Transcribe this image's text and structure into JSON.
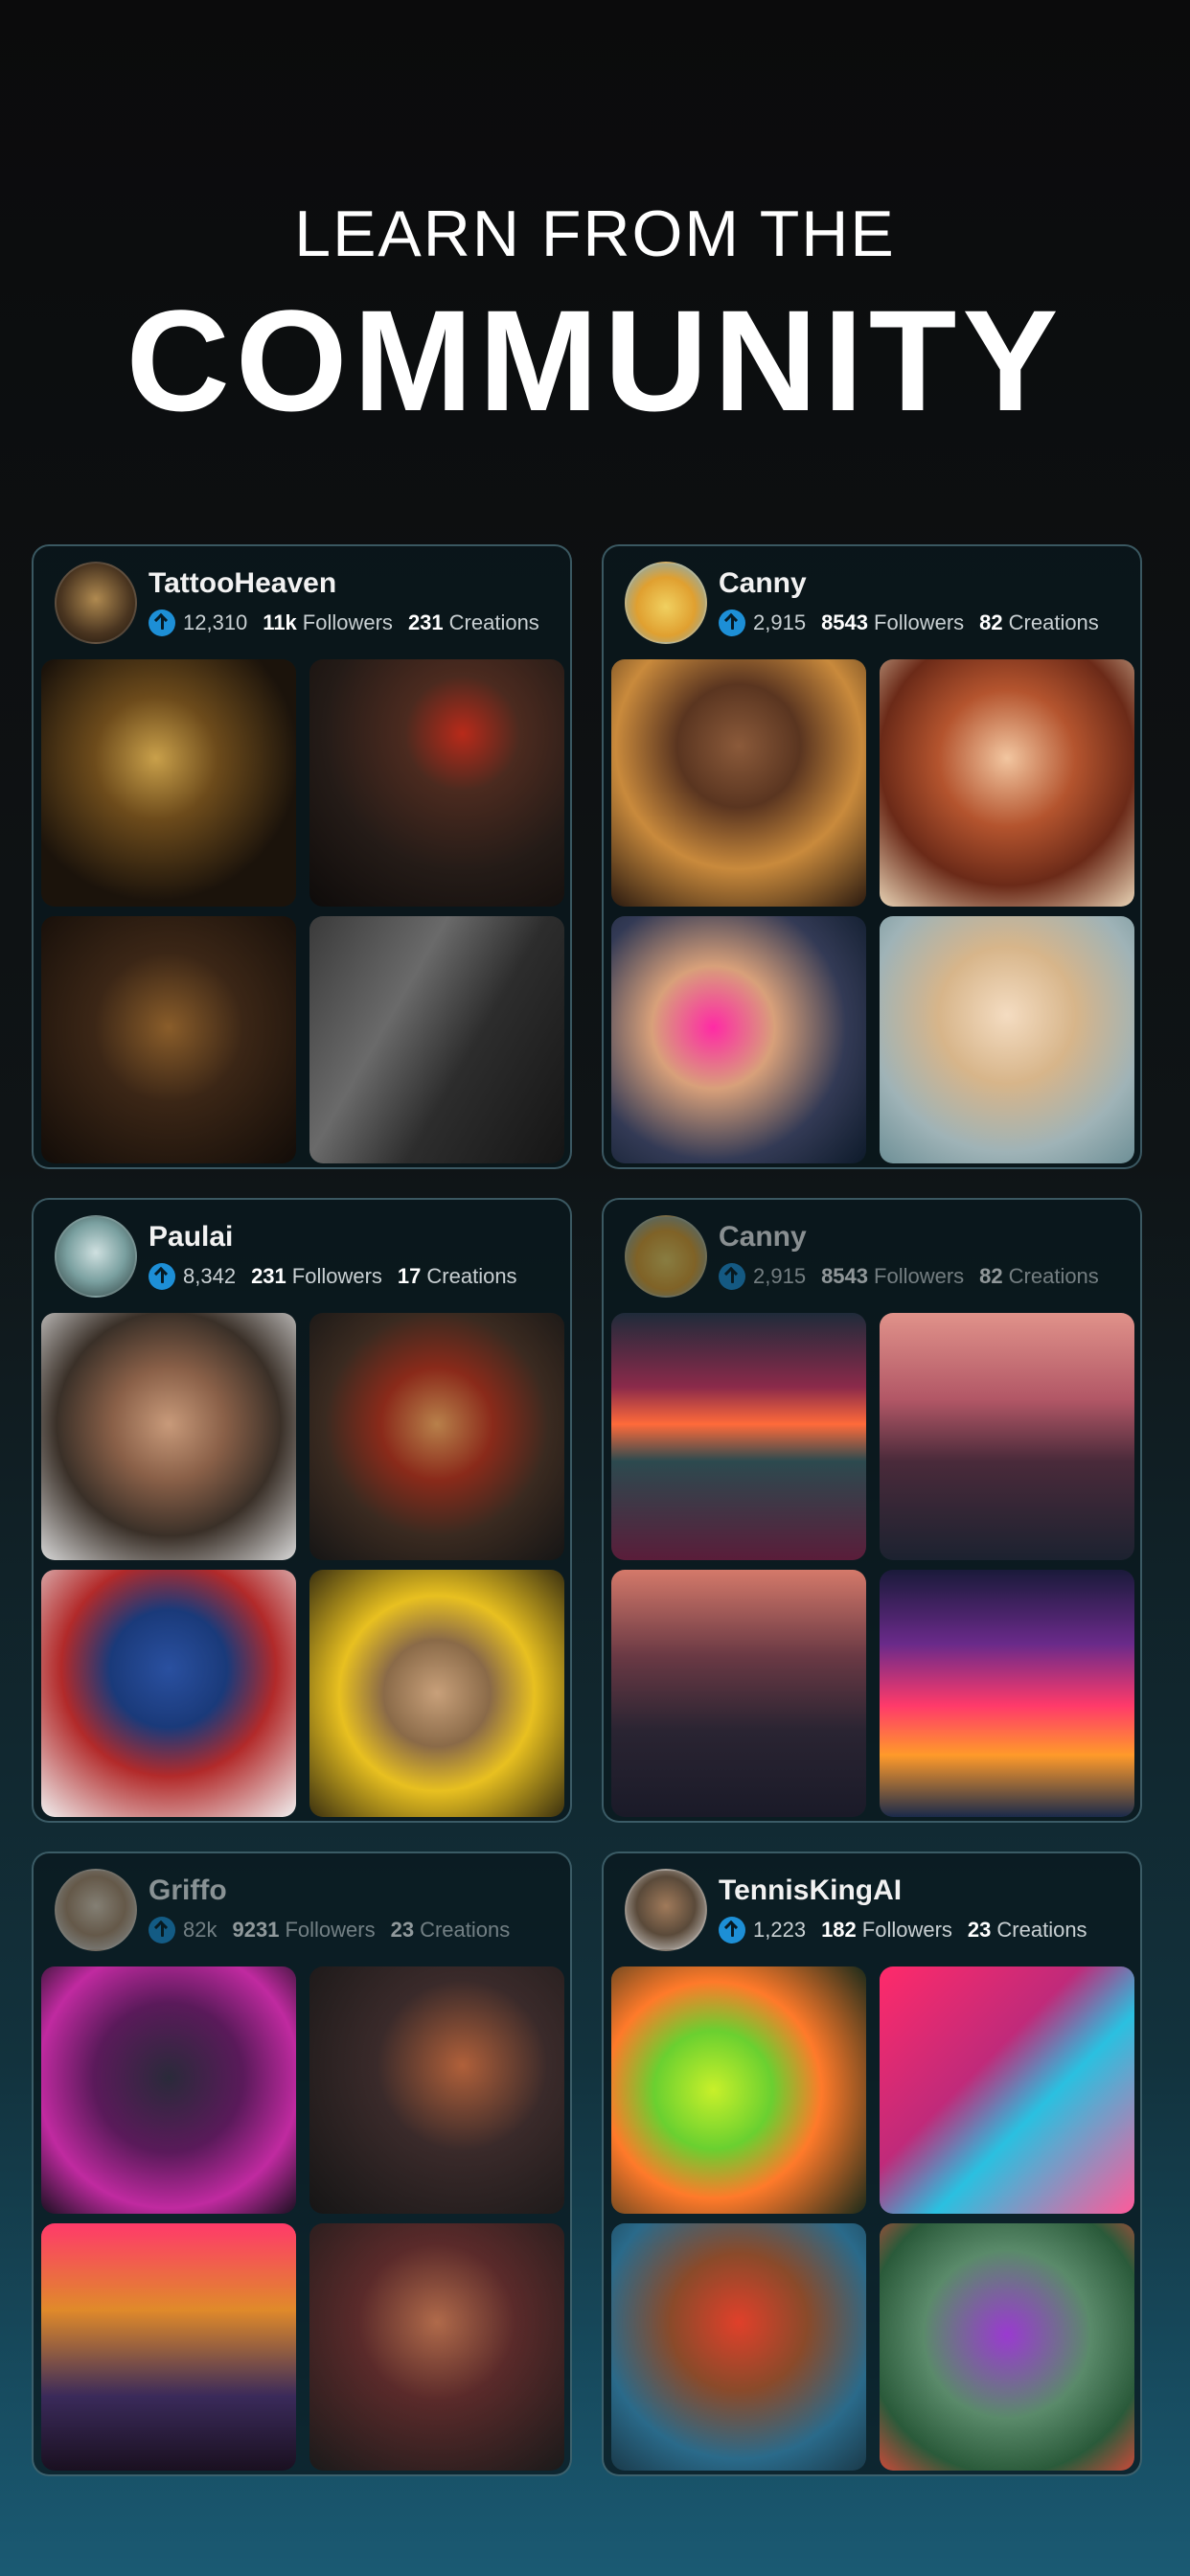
{
  "headline": {
    "small": "LEARN FROM THE",
    "big": "COMMUNITY"
  },
  "cards": [
    {
      "username": "TattooHeaven",
      "avatar": "tattoo-art-avatar",
      "score": "12,310",
      "followers_count": "11k",
      "followers_label": "Followers",
      "creations_count": "231",
      "creations_label": "Creations",
      "tiles": [
        "golden ornamental tattoo sleeve",
        "rose tattoo on forearm",
        "woman portrait tattoo",
        "black and grey portrait tattoo"
      ]
    },
    {
      "username": "Canny",
      "avatar": "hamster-avatar",
      "score": "2,915",
      "followers_count": "8543",
      "followers_label": "Followers",
      "creations_count": "82",
      "creations_label": "Creations",
      "tiles": [
        "woman portrait in city lights",
        "red-haired woman portrait",
        "woman in pink sportswear",
        "blonde woman portrait"
      ]
    },
    {
      "username": "Paulai",
      "avatar": "alien-face-avatar",
      "score": "8,342",
      "followers_count": "231",
      "followers_label": "Followers",
      "creations_count": "17",
      "creations_label": "Creations",
      "tiles": [
        "man portrait with beard",
        "injured man portrait",
        "superhero portrait",
        "man with halo portrait"
      ]
    },
    {
      "username": "Canny",
      "avatar": "hamster-avatar",
      "score": "2,915",
      "followers_count": "8543",
      "followers_label": "Followers",
      "creations_count": "82",
      "creations_label": "Creations",
      "tiles": [
        "alien landscape sunset",
        "pink mountain range",
        "dusky mountains",
        "neon galaxy lake"
      ]
    },
    {
      "username": "Griffo",
      "avatar": "woman-photo-avatar",
      "score": "82k",
      "followers_count": "9231",
      "followers_label": "Followers",
      "creations_count": "23",
      "creations_label": "Creations",
      "tiles": [
        "cyberpunk man",
        "man in dark train",
        "neon street crowd",
        "man in coat"
      ]
    },
    {
      "username": "TennisKingAI",
      "avatar": "man-sunglasses-avatar",
      "score": "1,223",
      "followers_count": "182",
      "followers_label": "Followers",
      "creations_count": "23",
      "creations_label": "Creations",
      "tiles": [
        "tennis balls neon",
        "tennis player abstract",
        "tennis player running",
        "female tennis player"
      ]
    }
  ]
}
